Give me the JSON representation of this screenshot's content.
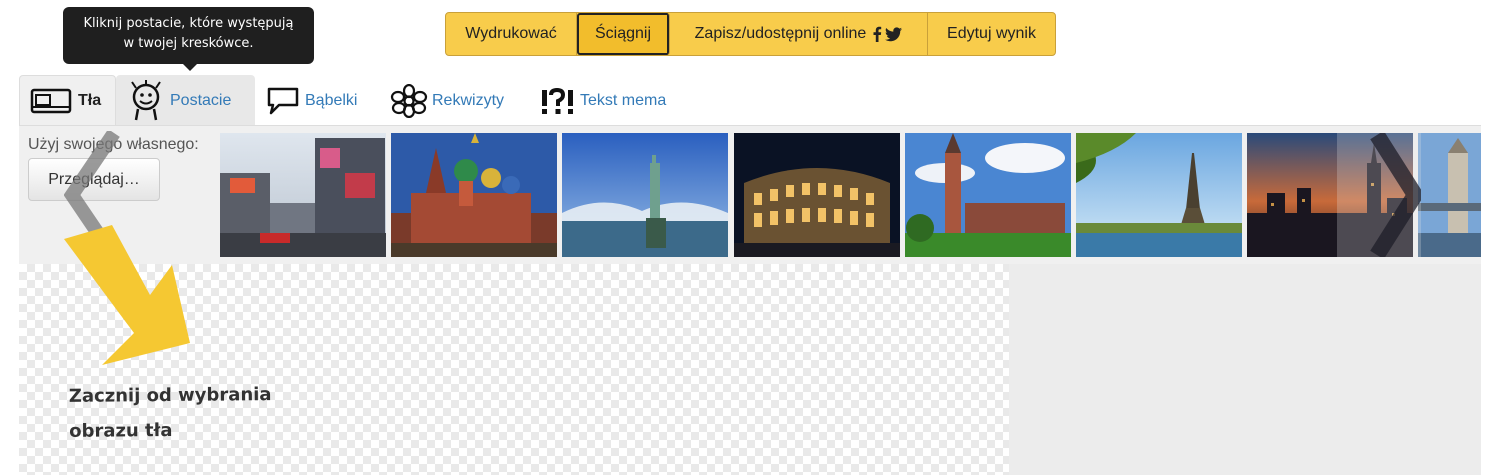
{
  "tooltip": {
    "line1": "Kliknij postacie, które występują",
    "line2": "w twojej kreskówce."
  },
  "toolbar": {
    "print_label": "Wydrukować",
    "download_label": "Ściągnij",
    "share_label": "Zapisz/udostępnij online",
    "edit_label": "Edytuj wynik",
    "accent_color": "#f8cc4b"
  },
  "tabs": [
    {
      "label": "Tła",
      "icon": "background-icon",
      "selected": true
    },
    {
      "label": "Postacie",
      "icon": "character-icon",
      "selected": false
    },
    {
      "label": "Bąbelki",
      "icon": "speech-bubble-icon",
      "selected": false
    },
    {
      "label": "Rekwizyty",
      "icon": "flower-icon",
      "selected": false
    },
    {
      "label": "Tekst mema",
      "icon": "meme-text-icon",
      "selected": false
    }
  ],
  "upload": {
    "label": "Użyj swojego własnego:",
    "browse_label": "Przeglądaj…"
  },
  "thumbnails": [
    {
      "name": "city-street"
    },
    {
      "name": "saint-basils-cathedral"
    },
    {
      "name": "statue-of-liberty"
    },
    {
      "name": "colosseum-night"
    },
    {
      "name": "town-hall"
    },
    {
      "name": "eiffel-tower"
    },
    {
      "name": "city-skyline-sunset"
    },
    {
      "name": "tower-bridge"
    }
  ],
  "canvas": {
    "hint_line1": "Zacznij od wybrania",
    "hint_line2": "obrazu tła"
  }
}
